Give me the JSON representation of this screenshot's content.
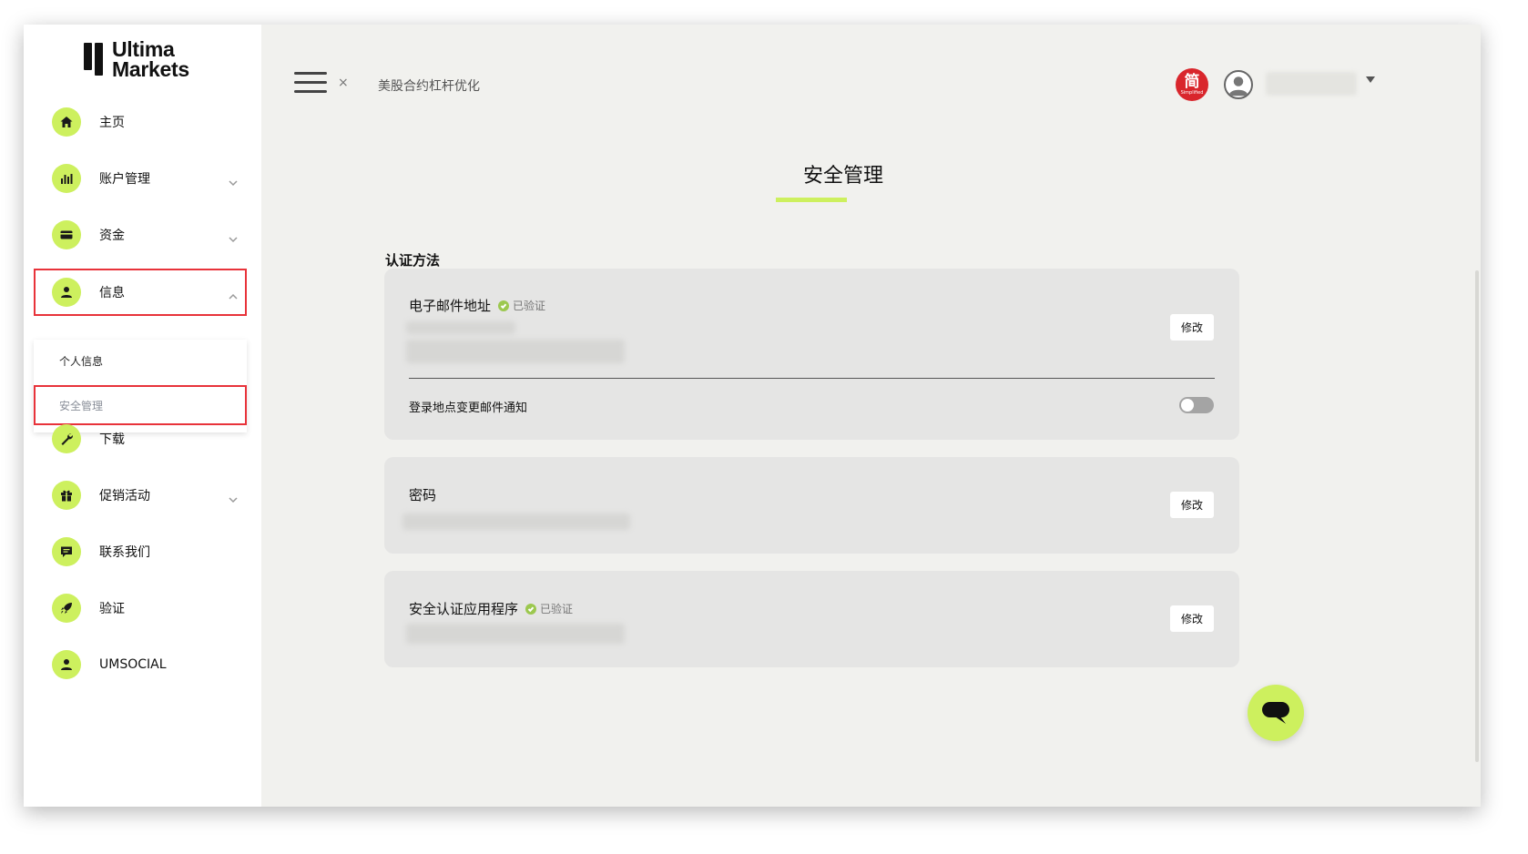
{
  "brand": {
    "line1": "Ultima",
    "line2": "Markets"
  },
  "sidebar": {
    "items": [
      {
        "label": "主页",
        "icon": "home-icon"
      },
      {
        "label": "账户管理",
        "icon": "bar-chart-icon"
      },
      {
        "label": "资金",
        "icon": "wallet-icon"
      },
      {
        "label": "信息",
        "icon": "user-icon"
      },
      {
        "label": "下载",
        "icon": "wrench-icon"
      },
      {
        "label": "促销活动",
        "icon": "gift-icon"
      },
      {
        "label": "联系我们",
        "icon": "chat-icon"
      },
      {
        "label": "验证",
        "icon": "rocket-icon"
      },
      {
        "label": "UMSOCIAL",
        "icon": "user-icon"
      }
    ],
    "submenu": [
      {
        "label": "个人信息"
      },
      {
        "label": "安全管理"
      }
    ]
  },
  "topbar": {
    "close_symbol": "×",
    "breadcrumb": "美股合约杠杆优化",
    "lang_big": "简",
    "lang_small": "Simplified"
  },
  "main": {
    "title": "安全管理",
    "section_title": "认证方法",
    "email_card": {
      "title": "电子邮件地址",
      "verified": "已验证",
      "edit_label": "修改",
      "toggle_label": "登录地点变更邮件通知"
    },
    "password_card": {
      "title": "密码",
      "edit_label": "修改"
    },
    "auth_card": {
      "title": "安全认证应用程序",
      "verified": "已验证",
      "edit_label": "修改"
    }
  },
  "colors": {
    "accent": "#cdf05e",
    "highlight": "#e8333a",
    "lang_badge": "#d9262c"
  }
}
